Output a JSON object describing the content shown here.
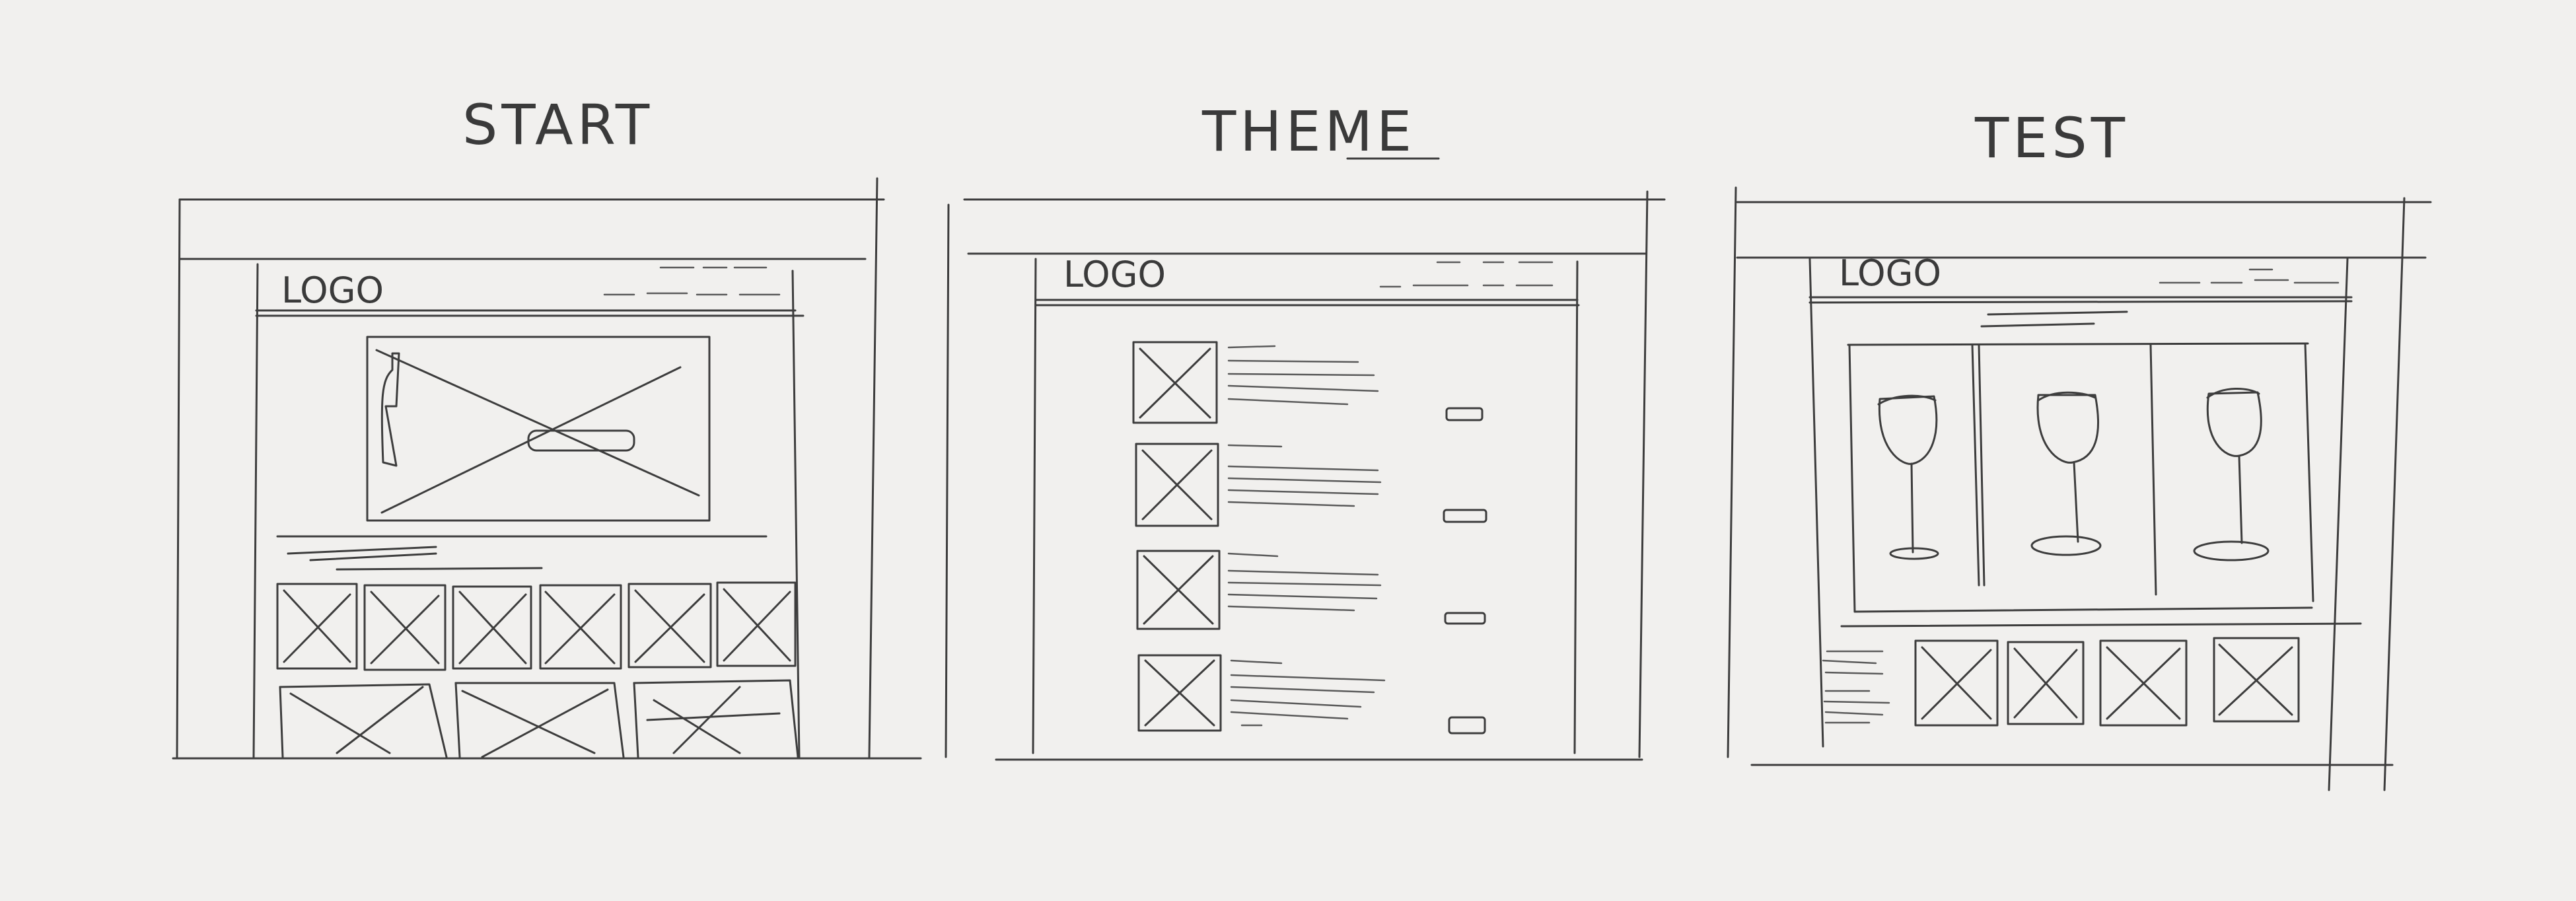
{
  "sketches": [
    {
      "title": "START",
      "logo": "LOGO"
    },
    {
      "title": "THEME",
      "logo": "LOGO"
    },
    {
      "title": "TEST",
      "logo": "LOGO"
    }
  ],
  "colors": {
    "paper": "#f1f0ee",
    "ink": "#3d3d3d"
  }
}
